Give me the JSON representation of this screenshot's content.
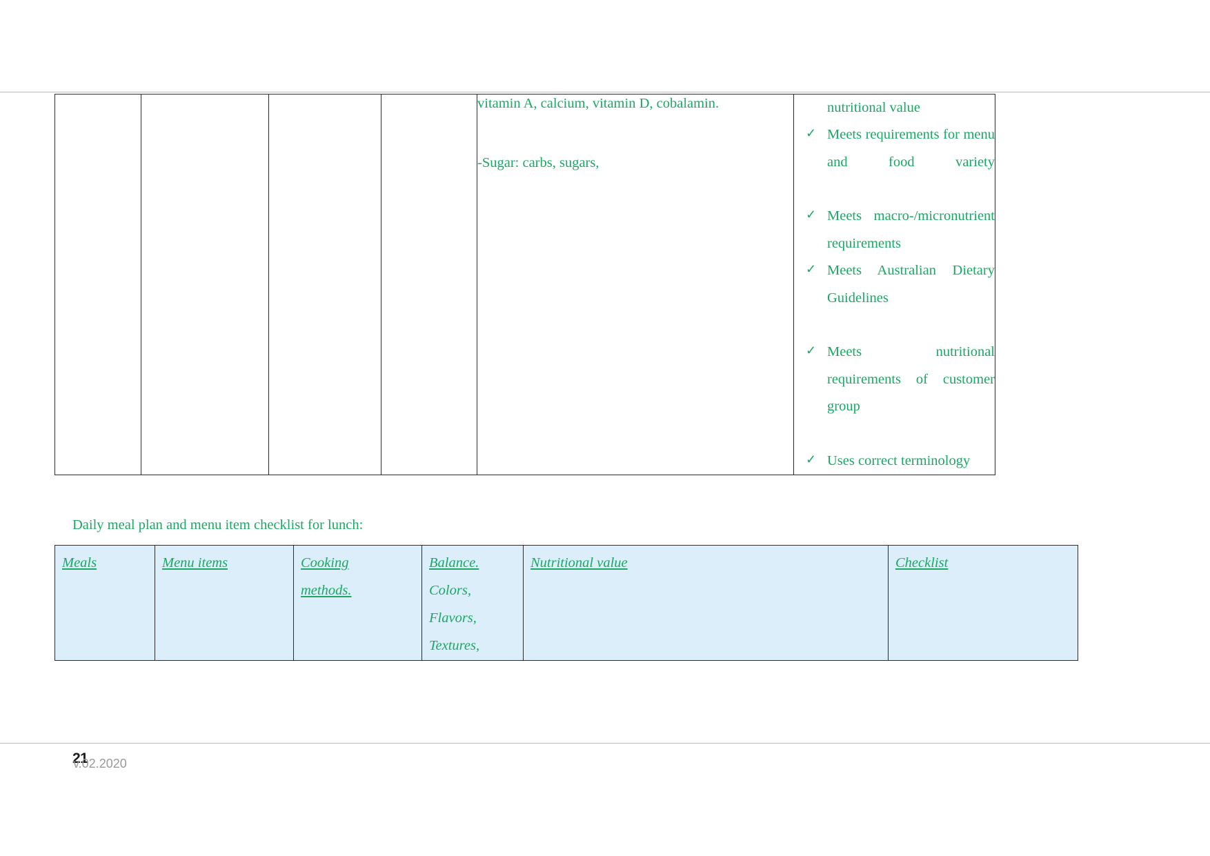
{
  "document": {
    "colors": {
      "green_text": "#1aa863",
      "table_header_fill": "#dbeefa",
      "border": "#2b2b2b",
      "rule": "#b9b9b9"
    }
  },
  "top_table": {
    "empty_columns": 4,
    "nutritional_value_cell": {
      "line1": "vitamin A, calcium, vitamin D, cobalamin.",
      "line2": "-Sugar: carbs, sugars,"
    },
    "checklist_cell": {
      "continued_line": "nutritional value",
      "bullet_icon": "check-icon",
      "items": [
        "Meets requirements for menu and food variety",
        "Meets macro-/micronutrient requirements",
        "Meets Australian Dietary Guidelines",
        "Meets nutritional requirements of customer group",
        "Uses correct terminology"
      ]
    }
  },
  "caption": "Daily meal plan and menu item checklist for lunch:",
  "bottom_table": {
    "headers": [
      "Meals",
      "Menu items",
      "Cooking methods.",
      "Balance.",
      "Nutritional value",
      "Checklist"
    ],
    "cooking_methods_lines": [
      "Cooking",
      "methods."
    ],
    "balance_header": "Balance.",
    "balance_subitems": [
      "Colors,",
      "Flavors,",
      "Textures,"
    ]
  },
  "footer": {
    "page_number": "21",
    "version": "v.02.2020"
  }
}
